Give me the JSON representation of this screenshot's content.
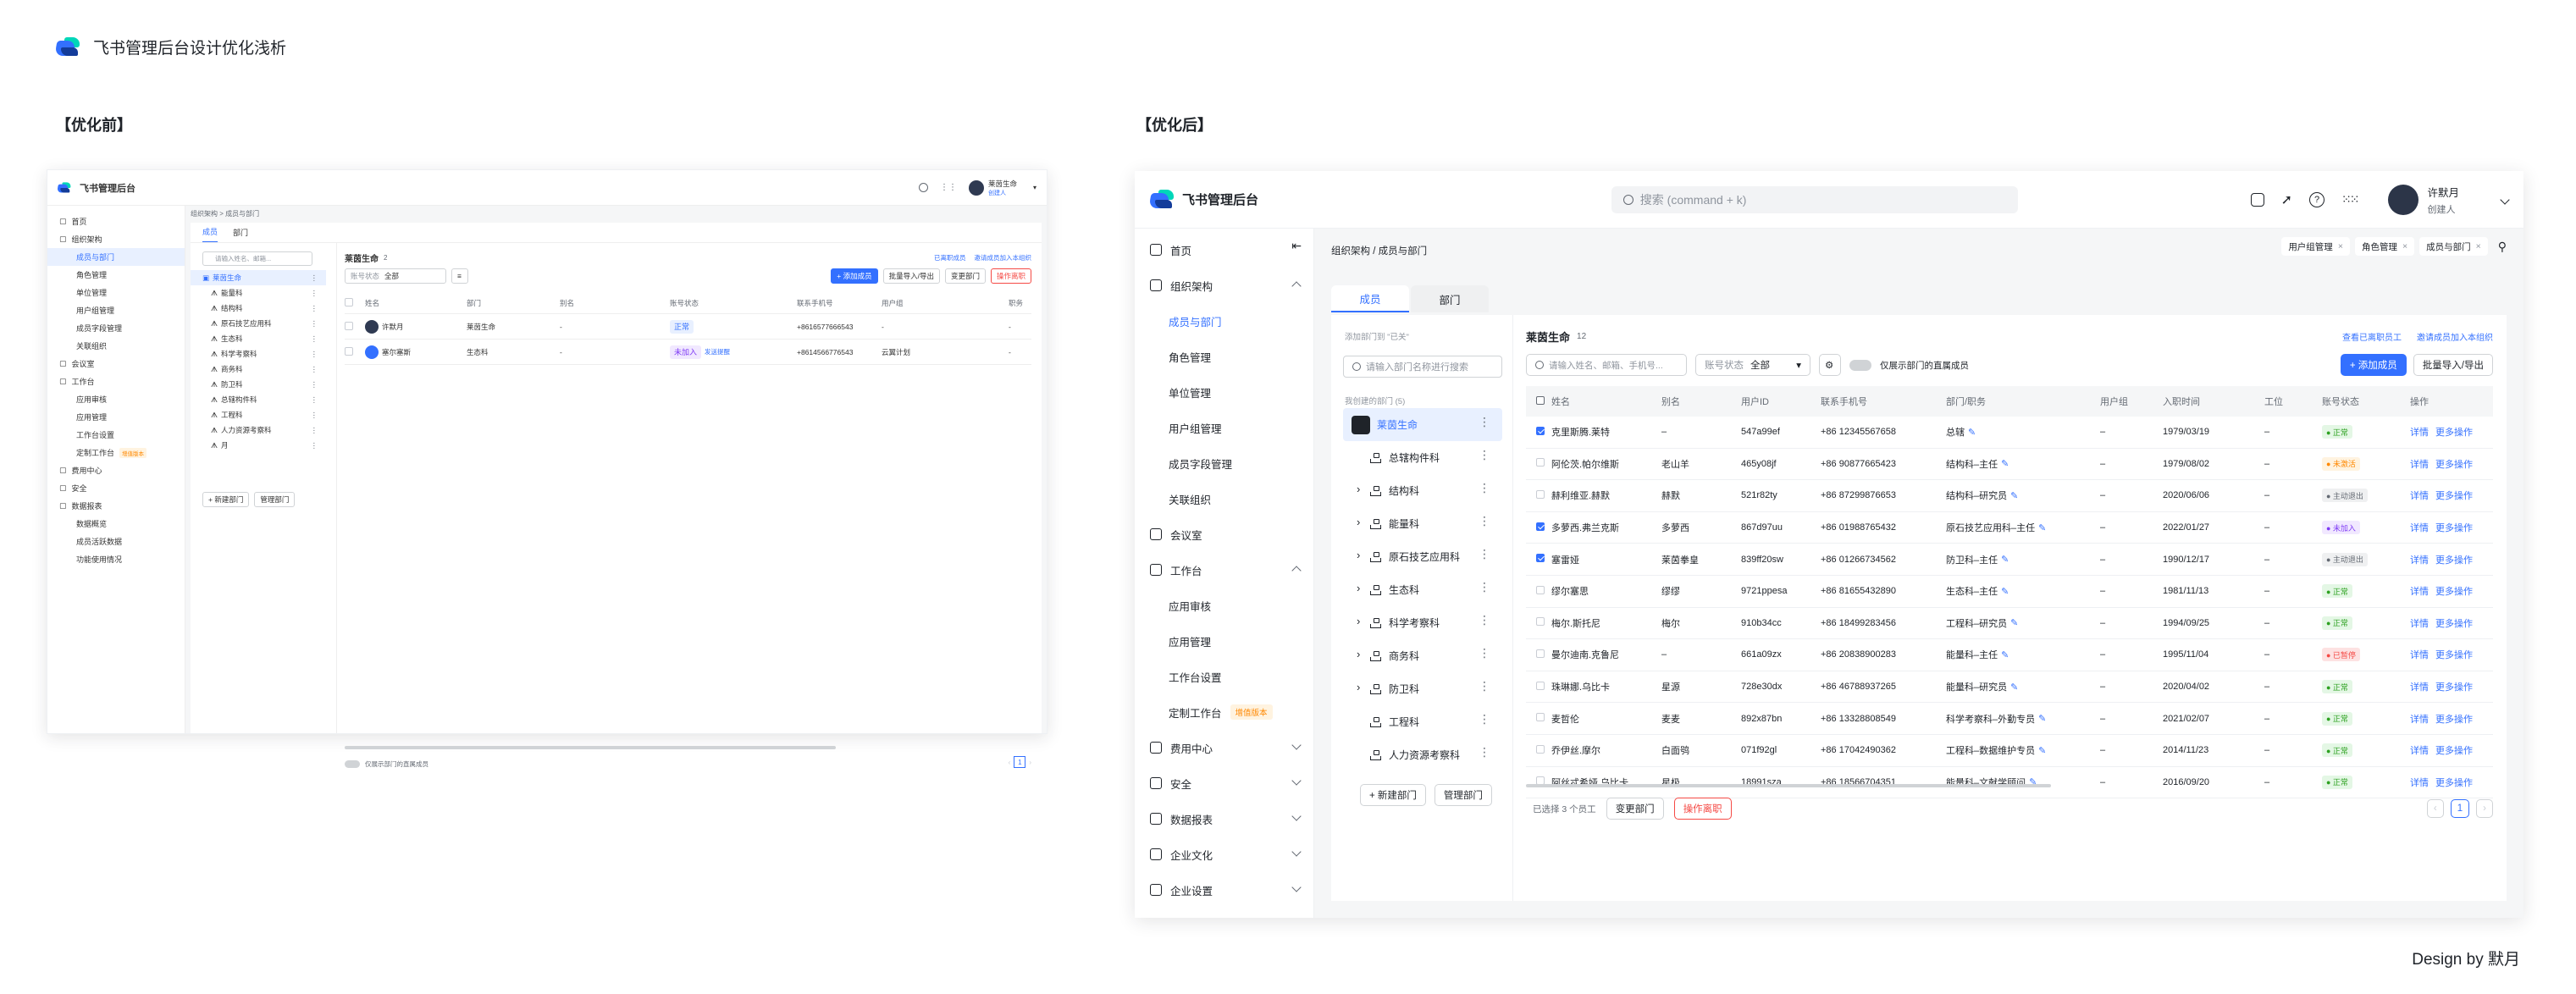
{
  "header": {
    "title": "飞书管理后台设计优化浅析"
  },
  "labels": {
    "before": "【优化前】",
    "after": "【优化后】"
  },
  "credit": "Design by 默月",
  "before": {
    "app_title": "飞书管理后台",
    "user": {
      "name": "莱茵生命",
      "role": "创建人"
    },
    "breadcrumb": "组织架构 > 成员与部门",
    "sidebar": [
      {
        "label": "首页",
        "type": "top"
      },
      {
        "label": "组织架构",
        "type": "top"
      },
      {
        "label": "成员与部门",
        "type": "sub",
        "active": true
      },
      {
        "label": "角色管理",
        "type": "sub"
      },
      {
        "label": "单位管理",
        "type": "sub"
      },
      {
        "label": "用户组管理",
        "type": "sub"
      },
      {
        "label": "成员字段管理",
        "type": "sub"
      },
      {
        "label": "关联组织",
        "type": "sub"
      },
      {
        "label": "会议室",
        "type": "top"
      },
      {
        "label": "工作台",
        "type": "top"
      },
      {
        "label": "应用审核",
        "type": "sub"
      },
      {
        "label": "应用管理",
        "type": "sub"
      },
      {
        "label": "工作台设置",
        "type": "sub"
      },
      {
        "label": "定制工作台",
        "type": "sub",
        "badge": "增值版本"
      },
      {
        "label": "费用中心",
        "type": "top"
      },
      {
        "label": "安全",
        "type": "top"
      },
      {
        "label": "数据报表",
        "type": "top"
      },
      {
        "label": "数据概览",
        "type": "sub"
      },
      {
        "label": "成员活跃数据",
        "type": "sub"
      },
      {
        "label": "功能使用情况",
        "type": "sub"
      }
    ],
    "tabs": [
      "成员",
      "部门"
    ],
    "search_placeholder": "请输入姓名、邮箱...",
    "tree": [
      "莱茵生命",
      "能量科",
      "结构科",
      "原石技艺应用科",
      "生态科",
      "科学考察科",
      "商务科",
      "防卫科",
      "总辖构件科",
      "工程科",
      "人力资源考察科",
      "月"
    ],
    "tree_buttons": [
      "+ 新建部门",
      "管理部门"
    ],
    "dept_title": "莱茵生命",
    "dept_count": "2",
    "links": [
      "已离职成员",
      "邀请成员加入本组织"
    ],
    "filter": {
      "label": "账号状态",
      "value": "全部"
    },
    "actions": [
      "+ 添加成员",
      "批量导入/导出",
      "变更部门",
      "操作离职"
    ],
    "columns": [
      "姓名",
      "部门",
      "别名",
      "账号状态",
      "联系手机号",
      "用户组",
      "职务"
    ],
    "rows": [
      {
        "name": "许默月",
        "dept": "莱茵生命",
        "alias": "-",
        "status": "正常",
        "phone": "+8616577666543",
        "group": "-",
        "title": "-"
      },
      {
        "name": "塞尔塞斯",
        "dept": "生态科",
        "alias": "-",
        "status": "未加入",
        "extra": "发送提醒",
        "phone": "+8614566776543",
        "group": "云翼计划",
        "title": "-"
      }
    ],
    "footer": "仅展示部门的直属成员",
    "page": "1"
  },
  "after": {
    "app_title": "飞书管理后台",
    "search_placeholder": "搜索 (command + k)",
    "user": {
      "name": "许默月",
      "role": "创建人"
    },
    "breadcrumb": "组织架构 / 成员与部门",
    "tags": [
      "用户组管理",
      "角色管理",
      "成员与部门"
    ],
    "sidebar": [
      {
        "label": "首页",
        "type": "top"
      },
      {
        "label": "组织架构",
        "type": "top",
        "open": true
      },
      {
        "label": "成员与部门",
        "type": "sub",
        "active": true
      },
      {
        "label": "角色管理",
        "type": "sub"
      },
      {
        "label": "单位管理",
        "type": "sub"
      },
      {
        "label": "用户组管理",
        "type": "sub"
      },
      {
        "label": "成员字段管理",
        "type": "sub"
      },
      {
        "label": "关联组织",
        "type": "sub"
      },
      {
        "label": "会议室",
        "type": "top"
      },
      {
        "label": "工作台",
        "type": "top",
        "open": true
      },
      {
        "label": "应用审核",
        "type": "sub"
      },
      {
        "label": "应用管理",
        "type": "sub"
      },
      {
        "label": "工作台设置",
        "type": "sub"
      },
      {
        "label": "定制工作台",
        "type": "sub",
        "badge": "增值版本"
      },
      {
        "label": "费用中心",
        "type": "top",
        "chev": true
      },
      {
        "label": "安全",
        "type": "top",
        "chev": true
      },
      {
        "label": "数据报表",
        "type": "top",
        "chev": true
      },
      {
        "label": "企业文化",
        "type": "top",
        "chev": true
      },
      {
        "label": "企业设置",
        "type": "top",
        "chev": true
      }
    ],
    "tabs": [
      "成员",
      "部门"
    ],
    "tree_hint": "添加部门到 \"已关\"",
    "tree_search": "请输入部门名称进行搜索",
    "tree_group": "我创建的部门 (5)",
    "tree": [
      {
        "label": "莱茵生命",
        "root": true
      },
      {
        "label": "总辖构件科"
      },
      {
        "label": "结构科",
        "arrow": true
      },
      {
        "label": "能量科",
        "arrow": true
      },
      {
        "label": "原石技艺应用科",
        "arrow": true
      },
      {
        "label": "生态科",
        "arrow": true
      },
      {
        "label": "科学考察科",
        "arrow": true
      },
      {
        "label": "商务科",
        "arrow": true
      },
      {
        "label": "防卫科",
        "arrow": true
      },
      {
        "label": "工程科"
      },
      {
        "label": "人力资源考察科"
      }
    ],
    "tree_buttons": [
      "+ 新建部门",
      "管理部门"
    ],
    "dept_title": "莱茵生命",
    "dept_count": "12",
    "links": [
      "查看已离职员工",
      "邀请成员加入本组织"
    ],
    "search_ph": "请输入姓名、邮箱、手机号...",
    "filter": {
      "label": "账号状态",
      "value": "全部"
    },
    "toggle_label": "仅展示部门的直属成员",
    "actions": [
      "+ 添加成员",
      "批量导入/导出"
    ],
    "columns": [
      "姓名",
      "别名",
      "用户ID",
      "联系手机号",
      "部门/职务",
      "用户组",
      "入职时间",
      "工位",
      "账号状态",
      "操作"
    ],
    "op": [
      "详情",
      "更多操作"
    ],
    "rows": [
      {
        "name": "克里斯腾.莱特",
        "alias": "–",
        "uid": "547a99ef",
        "phone": "+86 12345567658",
        "dept": "总辖",
        "group": "–",
        "date": "1979/03/19",
        "seat": "–",
        "status": "正常",
        "checked": true
      },
      {
        "name": "阿伦茨.帕尔维斯",
        "alias": "老山羊",
        "uid": "465y08jf",
        "phone": "+86 90877665423",
        "dept": "结构科–主任",
        "group": "–",
        "date": "1979/08/02",
        "seat": "–",
        "status": "未激活",
        "checked": false
      },
      {
        "name": "赫利维亚.赫默",
        "alias": "赫默",
        "uid": "521r82ty",
        "phone": "+86 87299876653",
        "dept": "结构科–研究员",
        "group": "–",
        "date": "2020/06/06",
        "seat": "–",
        "status": "主动退出",
        "checked": false
      },
      {
        "name": "多萝西.弗兰克斯",
        "alias": "多萝西",
        "uid": "867d97uu",
        "phone": "+86 01988765432",
        "dept": "原石技艺应用科–主任",
        "group": "–",
        "date": "2022/01/27",
        "seat": "–",
        "status": "未加入",
        "checked": true
      },
      {
        "name": "塞雷娅",
        "alias": "莱茵拳皇",
        "uid": "839ff20sw",
        "phone": "+86 01266734562",
        "dept": "防卫科–主任",
        "group": "–",
        "date": "1990/12/17",
        "seat": "–",
        "status": "主动退出",
        "checked": true
      },
      {
        "name": "缪尔塞思",
        "alias": "缪缪",
        "uid": "9721ppesa",
        "phone": "+86 81655432890",
        "dept": "生态科–主任",
        "group": "–",
        "date": "1981/11/13",
        "seat": "–",
        "status": "正常",
        "checked": false
      },
      {
        "name": "梅尔.斯托尼",
        "alias": "梅尔",
        "uid": "910b34cc",
        "phone": "+86 18499283456",
        "dept": "工程科–研究员",
        "group": "–",
        "date": "1994/09/25",
        "seat": "–",
        "status": "正常",
        "checked": false
      },
      {
        "name": "曼尔迪南.克鲁尼",
        "alias": "–",
        "uid": "661a09zx",
        "phone": "+86 20838900283",
        "dept": "能量科–主任",
        "group": "–",
        "date": "1995/11/04",
        "seat": "–",
        "status": "已暂停",
        "checked": false
      },
      {
        "name": "珠琳娜.乌比卡",
        "alias": "星源",
        "uid": "728e30dx",
        "phone": "+86 46788937265",
        "dept": "能量科–研究员",
        "group": "–",
        "date": "2020/04/02",
        "seat": "–",
        "status": "正常",
        "checked": false
      },
      {
        "name": "麦哲伦",
        "alias": "麦麦",
        "uid": "892x87bn",
        "phone": "+86 13328808549",
        "dept": "科学考察科–外勤专员",
        "group": "–",
        "date": "2021/02/07",
        "seat": "–",
        "status": "正常",
        "checked": false
      },
      {
        "name": "乔伊丝.摩尔",
        "alias": "白面鸮",
        "uid": "071f92gl",
        "phone": "+86 17042490362",
        "dept": "工程科–数据维护专员",
        "group": "–",
        "date": "2014/11/23",
        "seat": "–",
        "status": "正常",
        "checked": false
      },
      {
        "name": "阿丝忒希娅.乌比卡",
        "alias": "星极",
        "uid": "18991sza",
        "phone": "+86 18566704351",
        "dept": "能量科–文献学顾问",
        "group": "–",
        "date": "2016/09/20",
        "seat": "–",
        "status": "正常",
        "checked": false
      }
    ],
    "footer_selected": "已选择 3 个员工",
    "footer_actions": [
      "变更部门",
      "操作离职"
    ],
    "page": "1"
  },
  "colors": {
    "accent": "#3370ff",
    "danger": "#f54a45",
    "ok": "#34c724",
    "warn": "#ff8800"
  }
}
